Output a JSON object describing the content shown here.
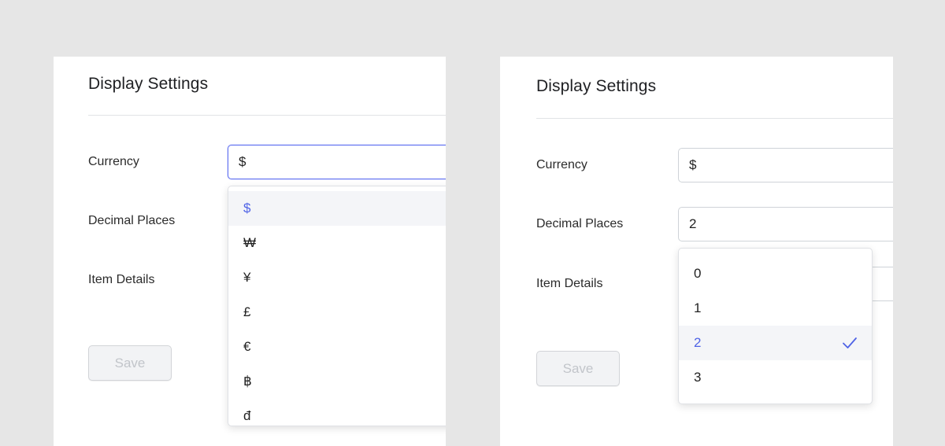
{
  "left": {
    "title": "Display Settings",
    "fields": {
      "currency": {
        "label": "Currency",
        "value": "$"
      },
      "decimal_places": {
        "label": "Decimal Places"
      },
      "item_details": {
        "label": "Item Details"
      }
    },
    "save_label": "Save",
    "currency_options": [
      "$",
      "₩",
      "¥",
      "£",
      "€",
      "฿",
      "đ"
    ],
    "selected_option": "$"
  },
  "right": {
    "title": "Display Settings",
    "fields": {
      "currency": {
        "label": "Currency",
        "value": "$"
      },
      "decimal_places": {
        "label": "Decimal Places",
        "value": "2"
      },
      "item_details": {
        "label": "Item Details"
      }
    },
    "save_label": "Save",
    "decimal_options": [
      "0",
      "1",
      "2",
      "3"
    ],
    "selected_option": "2"
  },
  "colors": {
    "accent": "#4f63e6",
    "focus_border": "#5b6cf0",
    "background": "#e6e6e6",
    "card": "#ffffff"
  }
}
